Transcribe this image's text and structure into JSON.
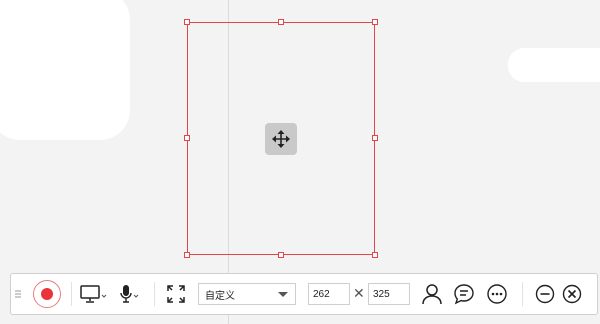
{
  "toolbar": {
    "preset_value": "自定义",
    "width_value": "262",
    "height_value": "325",
    "times_symbol": "✕"
  },
  "colors": {
    "selection_border": "#e0474c",
    "record_dot": "#e8333a"
  },
  "icons": [
    "drag-grip-icon",
    "record-icon",
    "screen-icon",
    "microphone-icon",
    "fullscreen-icon",
    "user-icon",
    "chat-icon",
    "more-icon",
    "minimize-icon",
    "close-icon",
    "move-icon"
  ]
}
